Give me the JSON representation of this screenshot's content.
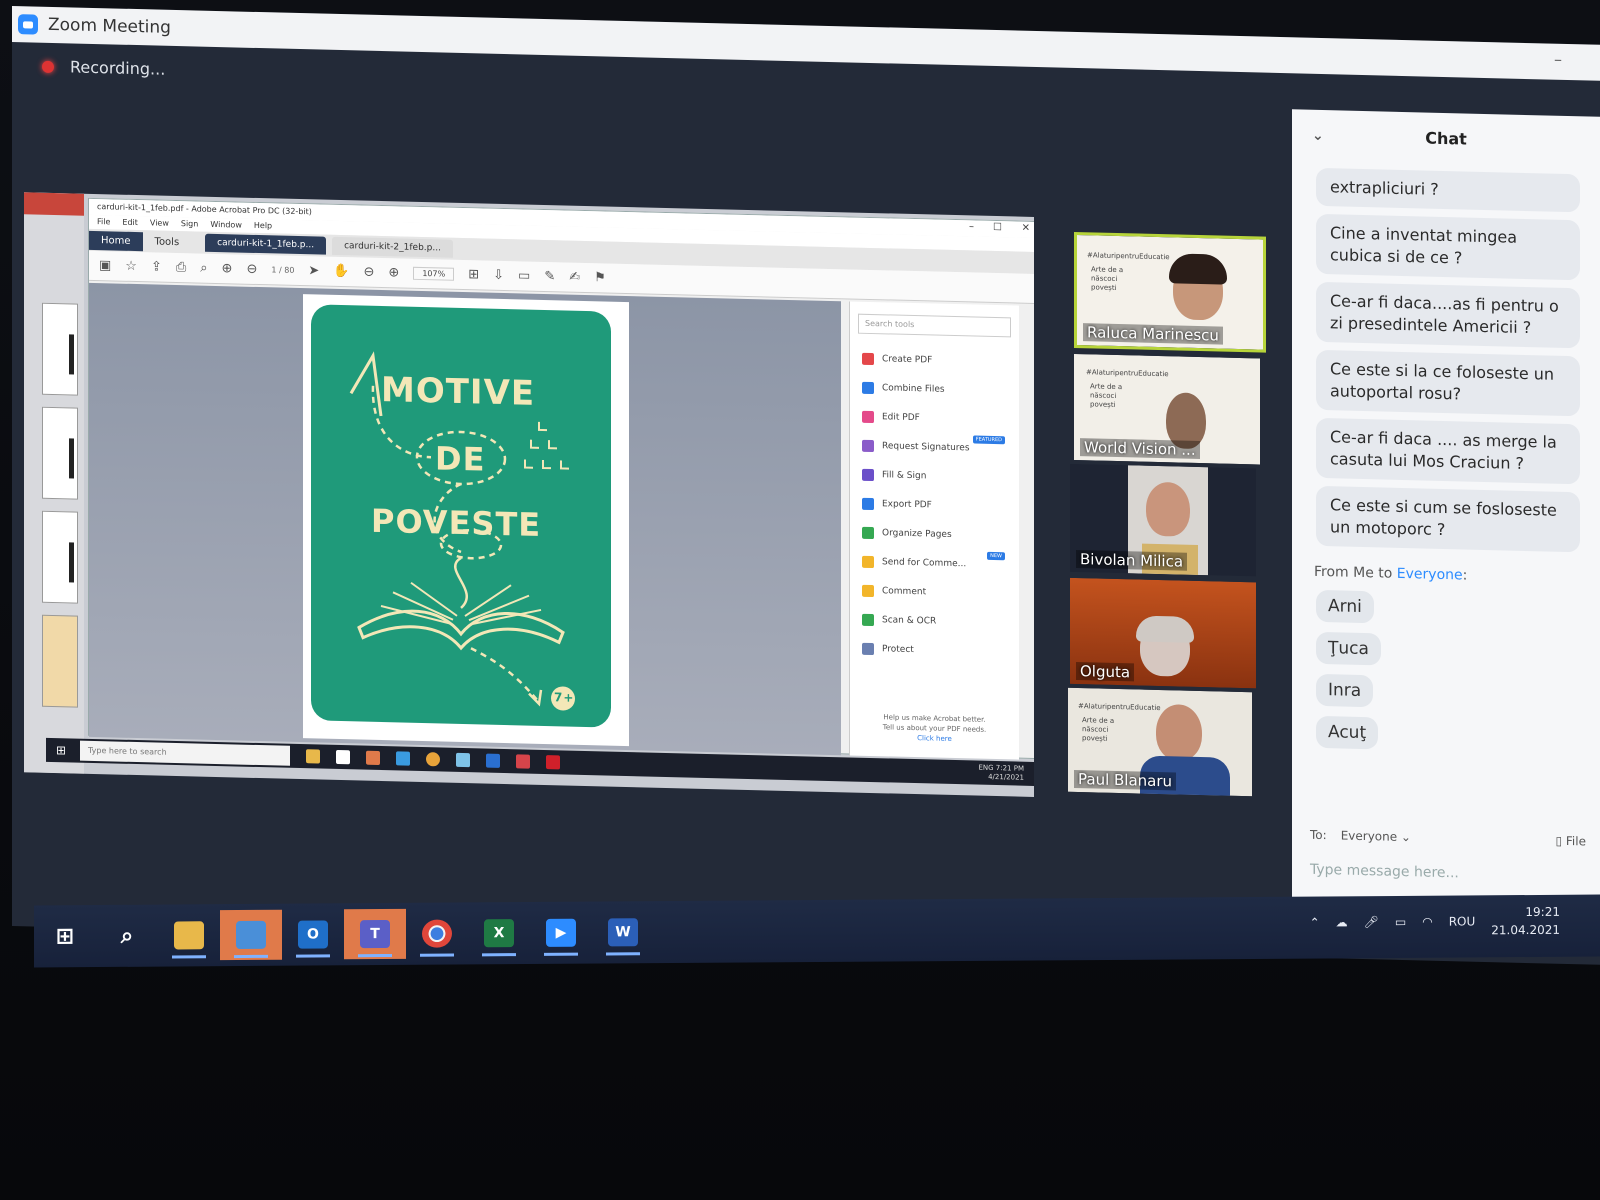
{
  "zoom": {
    "window_title": "Zoom Meeting",
    "recording_label": "Recording...",
    "minimize": "–"
  },
  "shared_screen": {
    "acrobat_title": "carduri-kit-1_1feb.pdf - Adobe Acrobat Pro DC (32-bit)",
    "menu": [
      "File",
      "Edit",
      "View",
      "Sign",
      "Window",
      "Help"
    ],
    "tabs": {
      "home": "Home",
      "tools": "Tools",
      "doc1": "carduri-kit-1_1feb.p...",
      "doc2": "carduri-kit-2_1feb.p..."
    },
    "page_indicator": "1 / 80",
    "zoom_level": "107%",
    "card": {
      "line1": "MOTIVE",
      "line2": "DE",
      "line3": "POVESTE",
      "age_badge": "7+"
    },
    "tools_pane": {
      "search_placeholder": "Search tools",
      "items": [
        {
          "label": "Create PDF",
          "color": "#e4474a",
          "badge": ""
        },
        {
          "label": "Combine Files",
          "color": "#2c7be5",
          "badge": ""
        },
        {
          "label": "Edit PDF",
          "color": "#e44a8a",
          "badge": ""
        },
        {
          "label": "Request Signatures",
          "color": "#8a5cc9",
          "badge": "FEATURED"
        },
        {
          "label": "Fill & Sign",
          "color": "#6b4fc9",
          "badge": ""
        },
        {
          "label": "Export PDF",
          "color": "#2c7be5",
          "badge": ""
        },
        {
          "label": "Organize Pages",
          "color": "#35a852",
          "badge": ""
        },
        {
          "label": "Send for Comme...",
          "color": "#f2b52a",
          "badge": "NEW"
        },
        {
          "label": "Comment",
          "color": "#f2b52a",
          "badge": ""
        },
        {
          "label": "Scan & OCR",
          "color": "#35a852",
          "badge": ""
        },
        {
          "label": "Protect",
          "color": "#6a7fb0",
          "badge": ""
        }
      ],
      "footer_line1": "Help us make Acrobat better.",
      "footer_line2": "Tell us about your PDF needs.",
      "footer_link": "Click here"
    },
    "inner_taskbar": {
      "search_placeholder": "Type here to search",
      "lang": "ENG",
      "time": "7:21 PM",
      "date": "4/21/2021"
    }
  },
  "participants": [
    {
      "name": "Raluca Marinescu",
      "bg": "#f4f1ea",
      "active": true
    },
    {
      "name": "World Vision ...",
      "bg": "#f2efe8",
      "active": false
    },
    {
      "name": "Bivolan Milica",
      "bg": "#1e2433",
      "active": false
    },
    {
      "name": "Olguta",
      "bg": "#c4531e",
      "active": false
    },
    {
      "name": "Paul Blanaru",
      "bg": "#eae7df",
      "active": false
    }
  ],
  "tile_caption": "#AlaturipentruEducatie",
  "tile_text": "Arte de a născoci povești",
  "chat": {
    "title": "Chat",
    "messages": [
      "extrapliciuri ?",
      "Cine a inventat mingea cubica si de ce ?",
      "Ce-ar fi daca....as fi pentru o zi presedintele Americii ?",
      "Ce este si la ce foloseste un autoportal rosu?",
      "Ce-ar fi daca .... as merge la casuta lui Mos Craciun ?",
      "Ce este si cum se fosloseste un motoporc ?"
    ],
    "from_prefix": "From Me to ",
    "from_target": "Everyone",
    "from_suffix": ":",
    "my_messages": [
      "Arni",
      "Ţuca",
      "Inra",
      "Acuţ"
    ],
    "to_label": "To:",
    "to_value": "Everyone ⌄",
    "file_label": "File",
    "input_placeholder": "Type message here..."
  },
  "taskbar": {
    "lang": "ROU",
    "time": "19:21",
    "date": "21.04.2021"
  }
}
